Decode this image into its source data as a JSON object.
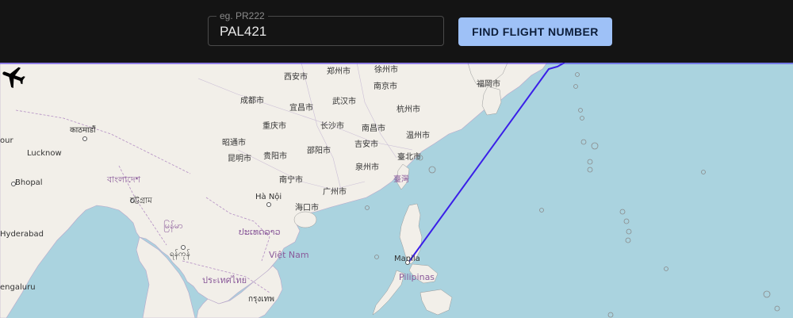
{
  "search": {
    "label": "eg. PR222",
    "value": "PAL421"
  },
  "button": {
    "label": "FIND FLIGHT NUMBER"
  },
  "colors": {
    "topbar": "#141414",
    "button": "#9ec1f7",
    "route": "#3a1fe8",
    "sea": "#aad3df",
    "land": "#f2efe9"
  },
  "map": {
    "icon": "airplane-icon",
    "labels": {
      "xian": "西安市",
      "zhengzhou": "郑州市",
      "xuzhou": "徐州市",
      "fukuoka": "福岡市",
      "chengdu": "成都市",
      "yichang": "宜昌市",
      "wuhan": "武汉市",
      "nanjing": "南京市",
      "hangzhou": "杭州市",
      "kathmandu": "काठमाडौं",
      "chongqing": "重庆市",
      "changsha": "长沙市",
      "nanchang": "南昌市",
      "wenzhou": "温州市",
      "our": "our",
      "lucknow": "Lucknow",
      "zhaotong": "昭通市",
      "shaoyang": "邵阳市",
      "jian": "吉安市",
      "kunming": "昆明市",
      "guiyang": "贵阳市",
      "quanzhou": "泉州市",
      "taipei": "臺北市",
      "bhopal": "Bhopal",
      "bangladesh": "বাংলাদেশ",
      "nanning": "南宁市",
      "taiwan": "臺灣",
      "guangzhou": "广州市",
      "chittagong": "চট্টগ্রাম",
      "hanoi": "Hà Nội",
      "haikou": "海口市",
      "hyderabad": "Hyderabad",
      "myanmar": "မြန်မာ",
      "laos": "ປະເທດລາວ",
      "yangon": "ရန်ကုန်",
      "vietnam": "Việt Nam",
      "manila": "Manila",
      "thailand": "ประเทศไทย",
      "pilipinas": "Pilipinas",
      "bengaluru": "engaluru",
      "bangkok": "กรุงเทพ"
    }
  }
}
